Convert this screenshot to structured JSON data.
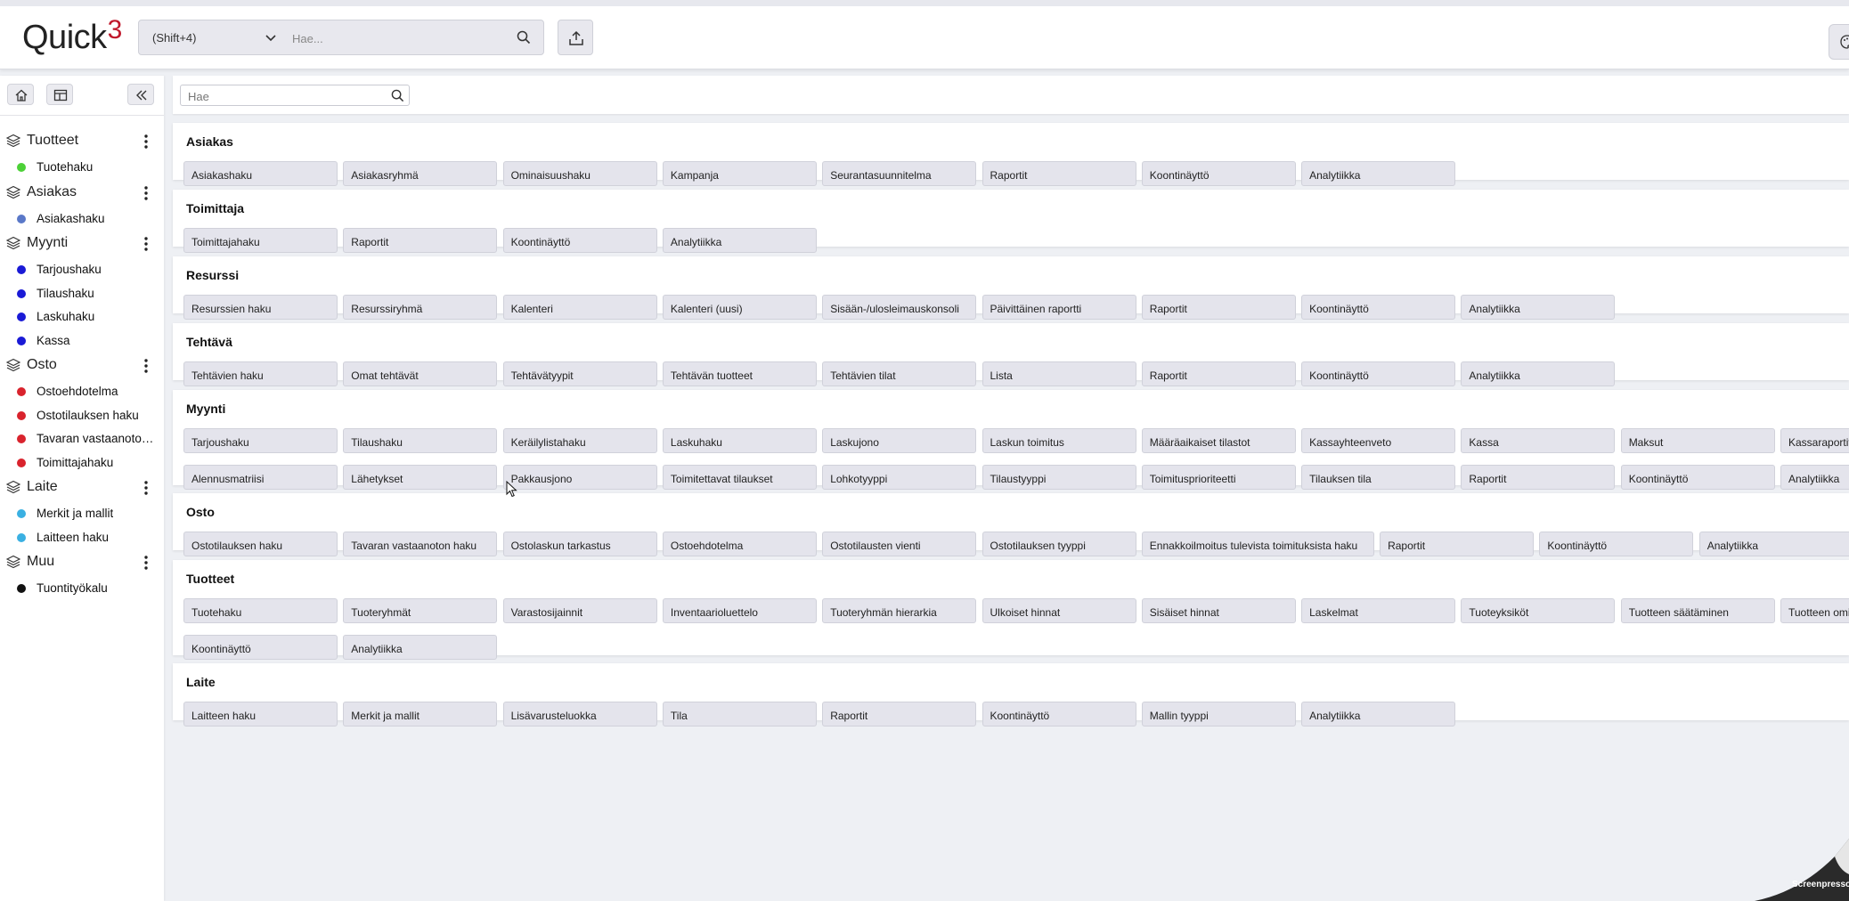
{
  "app": {
    "logo_text": "Quick",
    "logo_superscript": "3"
  },
  "header": {
    "search_scope": "(Shift+4)",
    "search_placeholder": "Hae...",
    "icons": [
      "chevron-down-icon",
      "search-icon",
      "export-icon",
      "palette-icon"
    ]
  },
  "sidebar": {
    "tools": [
      "home-icon",
      "layout-icon",
      "collapse-icon"
    ],
    "groups": [
      {
        "label": "Tuotteet",
        "items": [
          {
            "label": "Tuotehaku",
            "color": "#4cd137"
          }
        ]
      },
      {
        "label": "Asiakas",
        "items": [
          {
            "label": "Asiakashaku",
            "color": "#5a78c8"
          }
        ]
      },
      {
        "label": "Myynti",
        "items": [
          {
            "label": "Tarjoushaku",
            "color": "#1a1ad6"
          },
          {
            "label": "Tilaushaku",
            "color": "#1a1ad6"
          },
          {
            "label": "Laskuhaku",
            "color": "#1a1ad6"
          },
          {
            "label": "Kassa",
            "color": "#1a1ad6"
          }
        ]
      },
      {
        "label": "Osto",
        "items": [
          {
            "label": "Ostoehdotelma",
            "color": "#d9232d"
          },
          {
            "label": "Ostotilauksen haku",
            "color": "#d9232d"
          },
          {
            "label": "Tavaran vastaanoto…",
            "color": "#d9232d"
          },
          {
            "label": "Toimittajahaku",
            "color": "#d9232d"
          }
        ]
      },
      {
        "label": "Laite",
        "items": [
          {
            "label": "Merkit ja mallit",
            "color": "#3ab0e2"
          },
          {
            "label": "Laitteen haku",
            "color": "#3ab0e2"
          }
        ]
      },
      {
        "label": "Muu",
        "items": [
          {
            "label": "Tuontityökalu",
            "color": "#111111"
          }
        ]
      }
    ]
  },
  "filter": {
    "placeholder": "Hae"
  },
  "sections": [
    {
      "title": "Asiakas",
      "rows": [
        [
          "Asiakashaku",
          "Asiakasryhmä",
          "Ominaisuushaku",
          "Kampanja",
          "Seurantasuunnitelma",
          "Raportit",
          "Koontinäyttö",
          "Analytiikka"
        ]
      ]
    },
    {
      "title": "Toimittaja",
      "rows": [
        [
          "Toimittajahaku",
          "Raportit",
          "Koontinäyttö",
          "Analytiikka"
        ]
      ]
    },
    {
      "title": "Resurssi",
      "rows": [
        [
          "Resurssien haku",
          "Resurssiryhmä",
          "Kalenteri",
          "Kalenteri (uusi)",
          "Sisään-/ulosleimauskonsoli",
          "Päivittäinen raportti",
          "Raportit",
          "Koontinäyttö",
          "Analytiikka"
        ]
      ]
    },
    {
      "title": "Tehtävä",
      "rows": [
        [
          "Tehtävien haku",
          "Omat tehtävät",
          "Tehtävätyypit",
          "Tehtävän tuotteet",
          "Tehtävien tilat",
          "Lista",
          "Raportit",
          "Koontinäyttö",
          "Analytiikka"
        ]
      ]
    },
    {
      "title": "Myynti",
      "rows": [
        [
          "Tarjoushaku",
          "Tilaushaku",
          "Keräilylistahaku",
          "Laskuhaku",
          "Laskujono",
          "Laskun toimitus",
          "Määräaikaiset tilastot",
          "Kassayhteenveto",
          "Kassa",
          "Maksut",
          "Kassaraportit"
        ],
        [
          "Alennusmatriisi",
          "Lähetykset",
          "Pakkausjono",
          "Toimitettavat tilaukset",
          "Lohkotyyppi",
          "Tilaustyyppi",
          "Toimitusprioriteetti",
          "Tilauksen tila",
          "Raportit",
          "Koontinäyttö",
          "Analytiikka"
        ]
      ]
    },
    {
      "title": "Osto",
      "rows": [
        [
          "Ostotilauksen haku",
          "Tavaran vastaanoton haku",
          "Ostolaskun tarkastus",
          "Ostoehdotelma",
          "Ostotilausten vienti",
          "Ostotilauksen tyyppi",
          "Ennakkoilmoitus tulevista toimituksista haku",
          "Raportit",
          "Koontinäyttö",
          "Analytiikka"
        ]
      ]
    },
    {
      "title": "Tuotteet",
      "rows": [
        [
          "Tuotehaku",
          "Tuoteryhmät",
          "Varastosijainnit",
          "Inventaarioluettelo",
          "Tuoteryhmän hierarkia",
          "Ulkoiset hinnat",
          "Sisäiset hinnat",
          "Laskelmat",
          "Tuoteyksiköt",
          "Tuotteen säätäminen",
          "Tuotteen ominaisuudet"
        ],
        [
          "Koontinäyttö",
          "Analytiikka"
        ]
      ]
    },
    {
      "title": "Laite",
      "rows": [
        [
          "Laitteen haku",
          "Merkit ja mallit",
          "Lisävarusteluokka",
          "Tila",
          "Raportit",
          "Koontinäyttö",
          "Mallin tyyppi",
          "Analytiikka"
        ]
      ]
    }
  ],
  "watermark": {
    "text": "Screenpresso"
  }
}
